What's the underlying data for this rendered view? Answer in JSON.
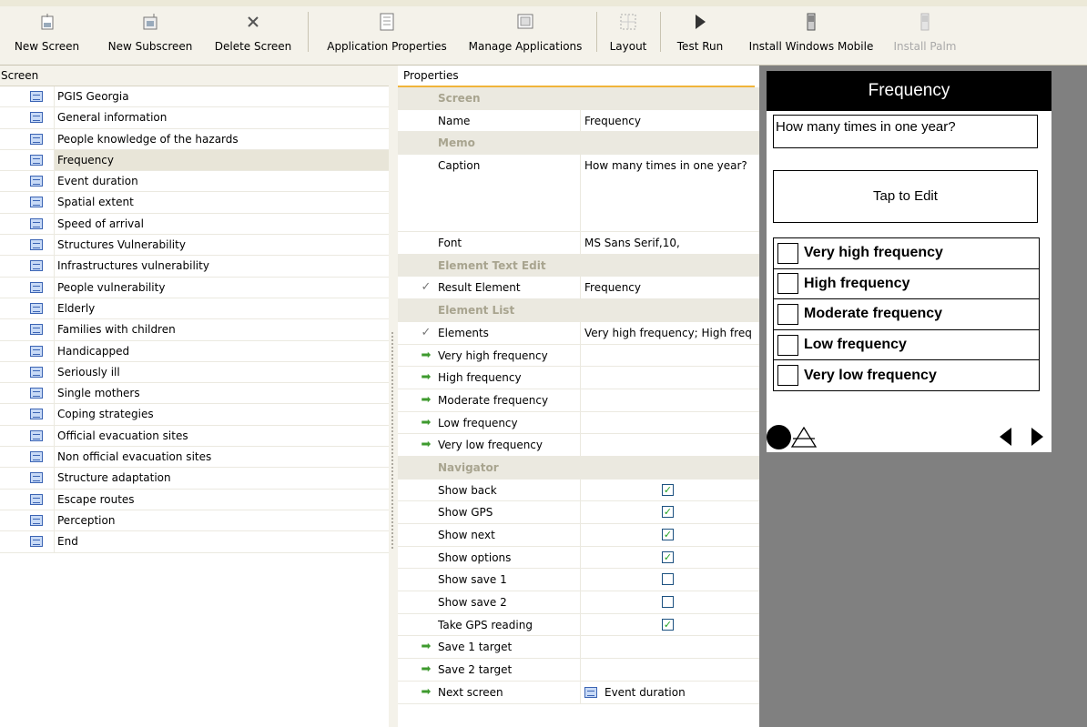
{
  "toolbar": {
    "buttons": [
      {
        "label": "New Screen",
        "icon": "new-screen-icon"
      },
      {
        "label": "New Subscreen",
        "icon": "new-subscreen-icon"
      },
      {
        "label": "Delete Screen",
        "icon": "delete-icon"
      },
      {
        "label": "Application Properties",
        "icon": "app-properties-icon"
      },
      {
        "label": "Manage Applications",
        "icon": "manage-apps-icon"
      },
      {
        "label": "Layout",
        "icon": "layout-icon"
      },
      {
        "label": "Test Run",
        "icon": "play-icon"
      },
      {
        "label": "Install Windows Mobile",
        "icon": "mobile-device-icon"
      },
      {
        "label": "Install Palm",
        "icon": "palm-device-icon",
        "disabled": true
      }
    ]
  },
  "screens": {
    "header": "Screen",
    "selected": "Frequency",
    "items": [
      "PGIS Georgia",
      "General information",
      "People knowledge of the hazards",
      "Frequency",
      "Event duration",
      "Spatial extent",
      "Speed of arrival",
      "Structures Vulnerability",
      "Infrastructures vulnerability",
      "People vulnerability",
      "Elderly",
      "Families with children",
      "Handicapped",
      "Seriously ill",
      "Single mothers",
      "Coping strategies",
      "Official evacuation sites",
      "Non official evacuation sites",
      "Structure adaptation",
      "Escape routes",
      "Perception",
      "End"
    ]
  },
  "properties": {
    "header": "Properties",
    "rows": [
      {
        "type": "category",
        "label": "Screen"
      },
      {
        "label": "Name",
        "value": "Frequency"
      },
      {
        "type": "category",
        "label": "Memo"
      },
      {
        "label": "Caption",
        "value": "How many times in one year?",
        "tall": true
      },
      {
        "label": "Font",
        "value": "MS Sans Serif,10,"
      },
      {
        "type": "category",
        "label": "Element Text Edit"
      },
      {
        "label": "Result Element",
        "value": "Frequency",
        "mark": "check"
      },
      {
        "type": "category",
        "label": "Element List"
      },
      {
        "label": "Elements",
        "value": "Very high frequency; High freq",
        "mark": "check"
      },
      {
        "label": "Very high frequency",
        "value": "",
        "mark": "arrow"
      },
      {
        "label": "High frequency",
        "value": "",
        "mark": "arrow"
      },
      {
        "label": "Moderate frequency",
        "value": "",
        "mark": "arrow"
      },
      {
        "label": "Low frequency",
        "value": "",
        "mark": "arrow"
      },
      {
        "label": "Very low frequency",
        "value": "",
        "mark": "arrow"
      },
      {
        "type": "category",
        "label": "Navigator"
      },
      {
        "label": "Show back",
        "checkbox": true
      },
      {
        "label": "Show GPS",
        "checkbox": true
      },
      {
        "label": "Show next",
        "checkbox": true
      },
      {
        "label": "Show options",
        "checkbox": true
      },
      {
        "label": "Show save 1",
        "checkbox": false
      },
      {
        "label": "Show save 2",
        "checkbox": false
      },
      {
        "label": "Take GPS reading",
        "checkbox": true
      },
      {
        "label": "Save 1 target",
        "value": "",
        "mark": "arrow"
      },
      {
        "label": "Save 2 target",
        "value": "",
        "mark": "arrow"
      },
      {
        "label": "Next screen",
        "value": "Event duration",
        "mark": "arrow",
        "screenIcon": true
      }
    ]
  },
  "preview": {
    "title": "Frequency",
    "caption": "How many times in one year?",
    "tap_label": "Tap to Edit",
    "options": [
      "Very high frequency",
      "High frequency",
      "Moderate frequency",
      "Low frequency",
      "Very low frequency"
    ]
  },
  "colors": {
    "toolbar_bg": "#f4f2ea",
    "selection_bg": "#e8e5d8",
    "category_bg": "#ebe9e0",
    "accent_underline": "#f0b43a",
    "preview_bg": "#808080",
    "check_green": "#21a121"
  }
}
